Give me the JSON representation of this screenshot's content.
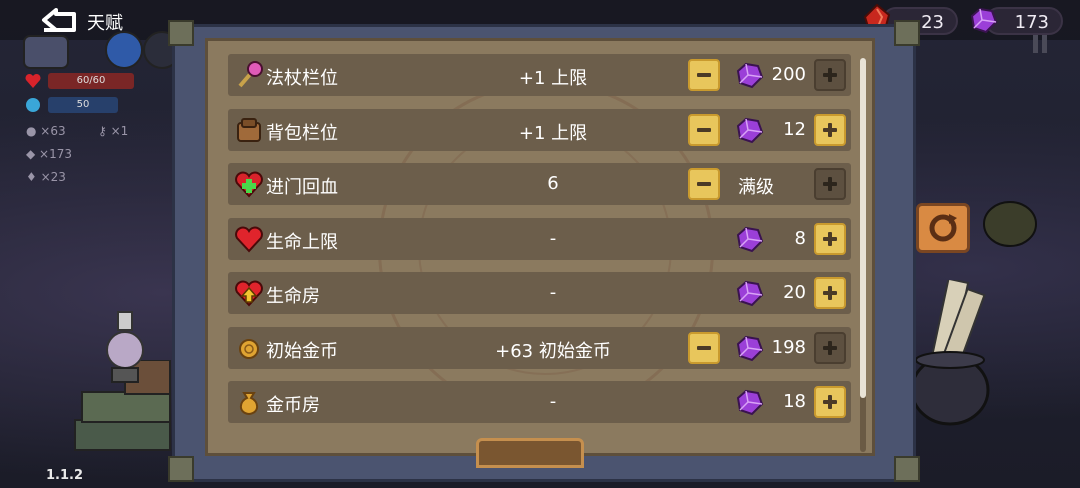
{
  "header": {
    "title": "天赋",
    "currencies": [
      {
        "icon": "red-crystal-icon",
        "value": "23"
      },
      {
        "icon": "purple-gem-icon",
        "value": "173"
      }
    ]
  },
  "left_panel": {
    "hp_text": "60/60",
    "mana_text": "50",
    "coins": "×63",
    "keys": "×1",
    "gems": "×173",
    "crystals": "×23"
  },
  "version": "1.1.2",
  "colors": {
    "accent_gold": "#e8c65c",
    "gem_purple": "#9b3fd8",
    "parchment": "#8b7a5f"
  },
  "talents": [
    {
      "icon": "wand-icon",
      "label": "法杖栏位",
      "value": "+1 上限",
      "minus": true,
      "minus_enabled": true,
      "cost": "200",
      "plus_enabled": false
    },
    {
      "icon": "backpack-icon",
      "label": "背包栏位",
      "value": "+1 上限",
      "minus": true,
      "minus_enabled": true,
      "cost": "12",
      "plus_enabled": true
    },
    {
      "icon": "heal-heart-icon",
      "label": "进门回血",
      "value": "6",
      "minus": true,
      "minus_enabled": true,
      "cost": "满级",
      "maxed": true,
      "plus_enabled": false
    },
    {
      "icon": "heart-icon",
      "label": "生命上限",
      "value": "-",
      "minus": false,
      "cost": "8",
      "plus_enabled": true
    },
    {
      "icon": "heart-room-icon",
      "label": "生命房",
      "value": "-",
      "minus": false,
      "cost": "20",
      "plus_enabled": true
    },
    {
      "icon": "coin-icon",
      "label": "初始金币",
      "value": "+63 初始金币",
      "minus": true,
      "minus_enabled": true,
      "cost": "198",
      "plus_enabled": false
    },
    {
      "icon": "money-bag-icon",
      "label": "金币房",
      "value": "-",
      "minus": false,
      "cost": "18",
      "plus_enabled": true
    }
  ]
}
